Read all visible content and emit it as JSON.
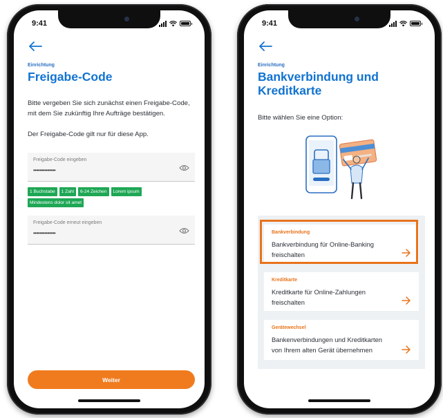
{
  "status_bar": {
    "time": "9:41"
  },
  "left_screen": {
    "eyebrow": "Einrichtung",
    "title": "Freigabe-Code",
    "intro": "Bitte vergeben Sie sich zunächst einen Freigabe-Code, mit dem Sie zukünftig Ihre Aufträge bestätigen.",
    "note": "Der Freigabe-Code gilt nur für diese App.",
    "field1": {
      "label": "Freigabe-Code eingeben",
      "value": "••••••••••••••"
    },
    "rules": [
      "1 Buchstabe",
      "1 Zahl",
      "6-24 Zeichen",
      "Lorem ipsum",
      "Mindestens dolor sit amet"
    ],
    "field2": {
      "label": "Freigabe-Code erneut eingeben",
      "value": "••••••••••••••"
    },
    "cta": "Weiter"
  },
  "right_screen": {
    "eyebrow": "Einrichtung",
    "title_line1": "Bankverbindung und",
    "title_line2": "Kreditkarte",
    "prompt": "Bitte wählen Sie eine Option:",
    "options": [
      {
        "title": "Bankverbindung",
        "line1": "Bankverbindung für Online-Banking",
        "line2": "freischalten"
      },
      {
        "title": "Kreditkarte",
        "line1": "Kreditkarte für Online-Zahlungen",
        "line2": "freischalten"
      },
      {
        "title": "Gerätewechsel",
        "line1": "Bankenverbindungen und Kreditkarten",
        "line2": "von Ihrem alten Gerät übernehmen"
      }
    ]
  },
  "colors": {
    "accent_blue": "#1273d1",
    "accent_orange": "#f07b1e",
    "chip_green": "#1ea755",
    "panel_bg": "#eef1f4"
  },
  "icons": [
    "back-arrow-icon",
    "eye-icon",
    "arrow-right-icon",
    "signal-icon",
    "wifi-icon",
    "battery-icon"
  ]
}
